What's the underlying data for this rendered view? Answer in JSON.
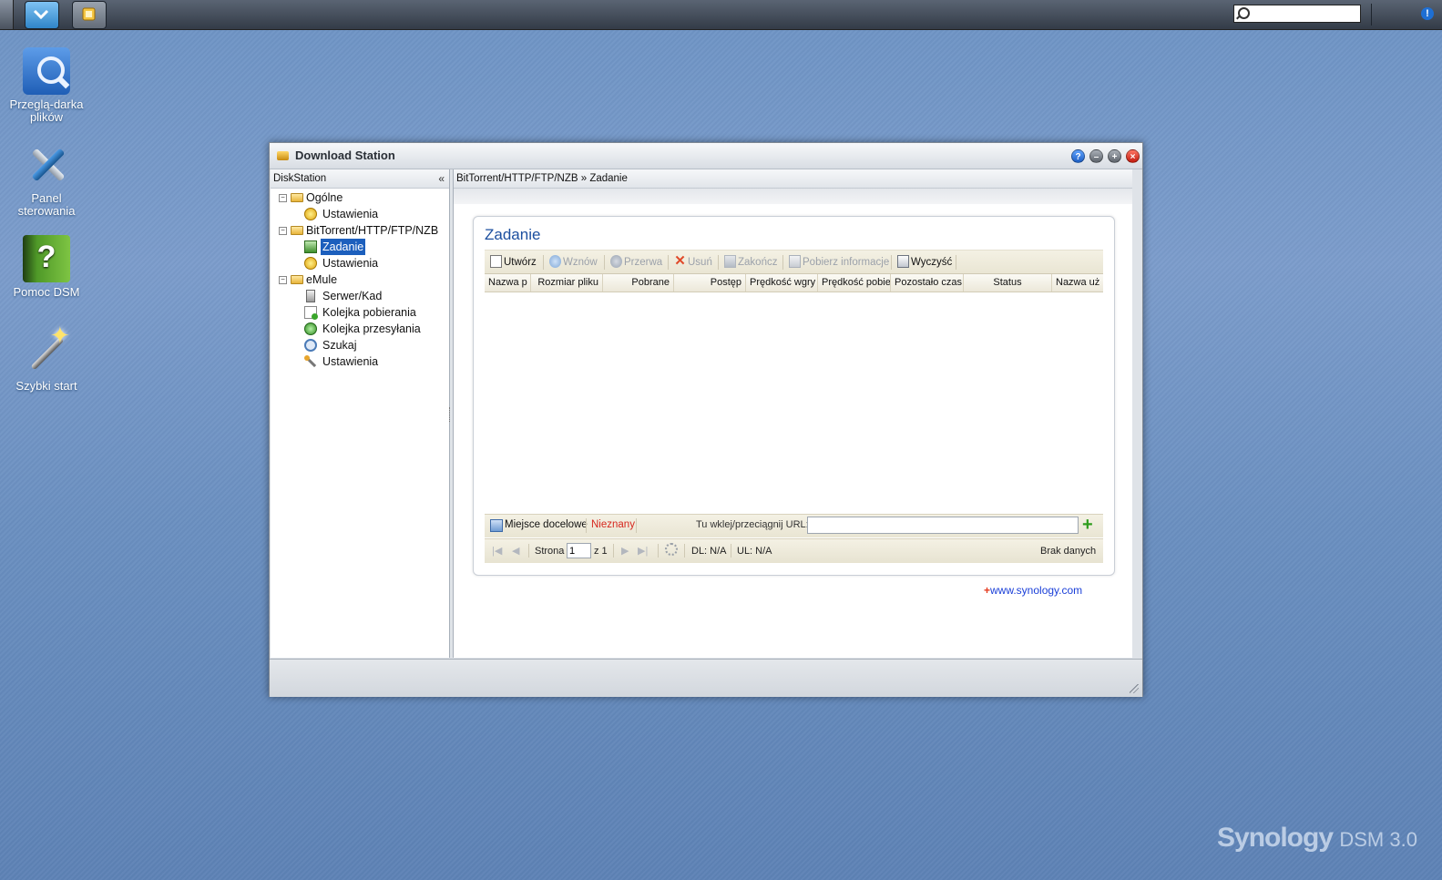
{
  "taskbar": {
    "search_placeholder": "",
    "info_icon": "!"
  },
  "desktop": {
    "icons": [
      {
        "label": "Przeglą-darka plików",
        "icon": "file-browser-icon"
      },
      {
        "label": "Panel sterowania",
        "icon": "control-panel-icon"
      },
      {
        "label": "Pomoc DSM",
        "icon": "help-book-icon"
      },
      {
        "label": "Szybki start",
        "icon": "magic-wand-icon"
      }
    ],
    "brand": "Synology",
    "brand_version": "DSM 3.0"
  },
  "window": {
    "title": "Download Station",
    "buttons": {
      "help": "?",
      "minimize": "–",
      "maximize": "+",
      "close": "×"
    }
  },
  "sidebar": {
    "header": "DiskStation",
    "collapse_glyph": "«",
    "groups": [
      {
        "label": "Ogólne",
        "items": [
          "Ustawienia"
        ]
      },
      {
        "label": "BitTorrent/HTTP/FTP/NZB",
        "items": [
          "Zadanie",
          "Ustawienia"
        ]
      },
      {
        "label": "eMule",
        "items": [
          "Serwer/Kad",
          "Kolejka pobierania",
          "Kolejka przesyłania",
          "Szukaj",
          "Ustawienia"
        ]
      }
    ],
    "selected": "Zadanie"
  },
  "main": {
    "breadcrumb": "BitTorrent/HTTP/FTP/NZB » Zadanie",
    "panel_title": "Zadanie",
    "toolbar": {
      "create": "Utwórz",
      "resume": "Wznów",
      "pause": "Przerwa",
      "delete": "Usuń",
      "finish": "Zakończ",
      "get_info": "Pobierz informacje",
      "clear": "Wyczyść"
    },
    "columns": [
      "Nazwa p",
      "Rozmiar pliku",
      "Pobrane",
      "Postęp",
      "Prędkość wgry",
      "Prędkość pobie",
      "Pozostało czas",
      "Status",
      "Nazwa uż"
    ],
    "destination": {
      "label": "Miejsce docelowe",
      "value": "Nieznany"
    },
    "url": {
      "label": "Tu wklej/przeciągnij URL:",
      "value": ""
    },
    "pager": {
      "page_label": "Strona",
      "page_value": "1",
      "of_label": "z 1",
      "dl": "DL: N/A",
      "ul": "UL: N/A",
      "empty": "Brak danych"
    },
    "link": "www.synology.com"
  }
}
